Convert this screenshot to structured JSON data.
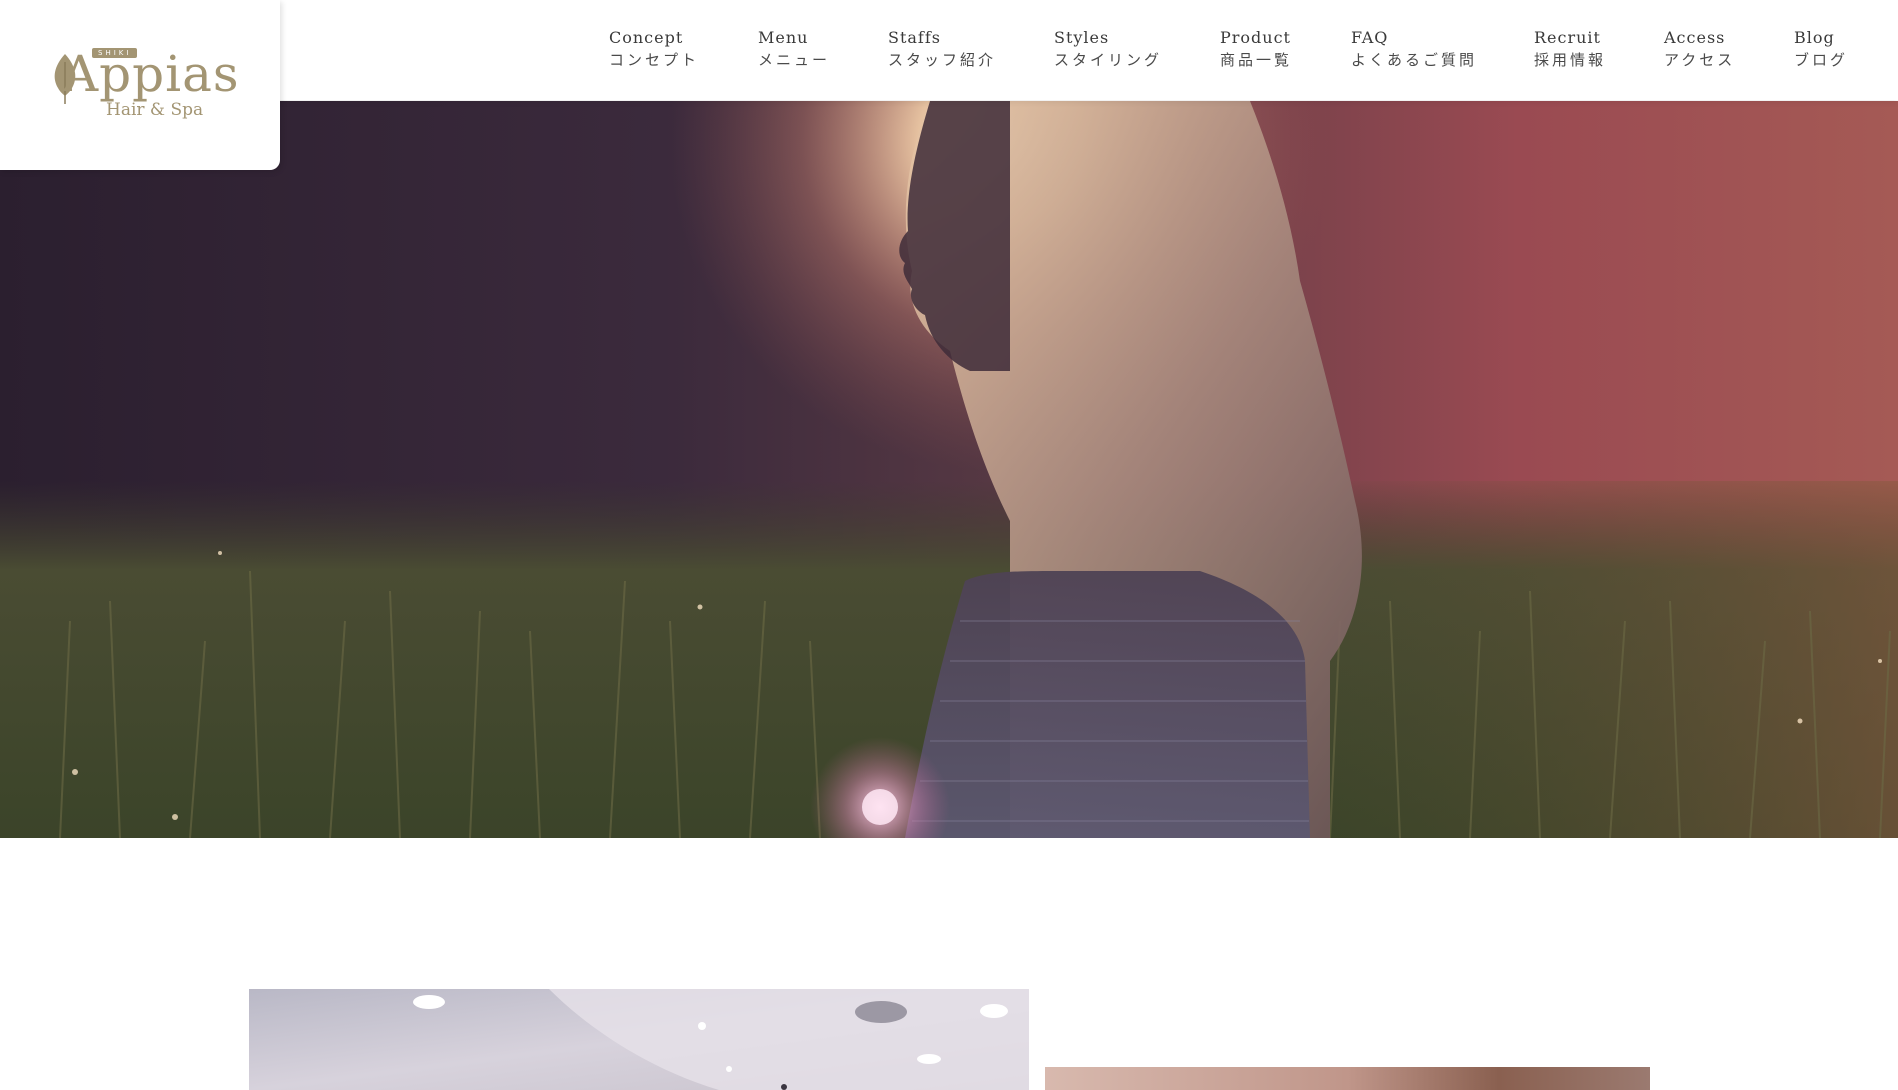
{
  "logo": {
    "tag": "SHIKI",
    "name": "Appias",
    "subtitle": "Hair & Spa",
    "alt": "Appias Hair & Spa"
  },
  "nav": {
    "items": [
      {
        "en": "Concept",
        "ja": "コンセプト"
      },
      {
        "en": "Menu",
        "ja": "メニュー"
      },
      {
        "en": "Staffs",
        "ja": "スタッフ紹介"
      },
      {
        "en": "Styles",
        "ja": "スタイリング"
      },
      {
        "en": "Product",
        "ja": "商品一覧"
      },
      {
        "en": "FAQ",
        "ja": "よくあるご質問"
      },
      {
        "en": "Recruit",
        "ja": "採用情報"
      },
      {
        "en": "Access",
        "ja": "アクセス"
      },
      {
        "en": "Blog",
        "ja": "ブログ"
      }
    ]
  },
  "hero": {
    "alt": "Woman with long hair standing in a grassy field, backlit by sunset"
  },
  "section": {
    "photo_left_alt": "Salon interior ceiling with lights",
    "photo_right_alt": "Salon photo"
  },
  "colors": {
    "brand_gold": "#a39573",
    "nav_text": "#3a3a3a",
    "background": "#ffffff"
  }
}
